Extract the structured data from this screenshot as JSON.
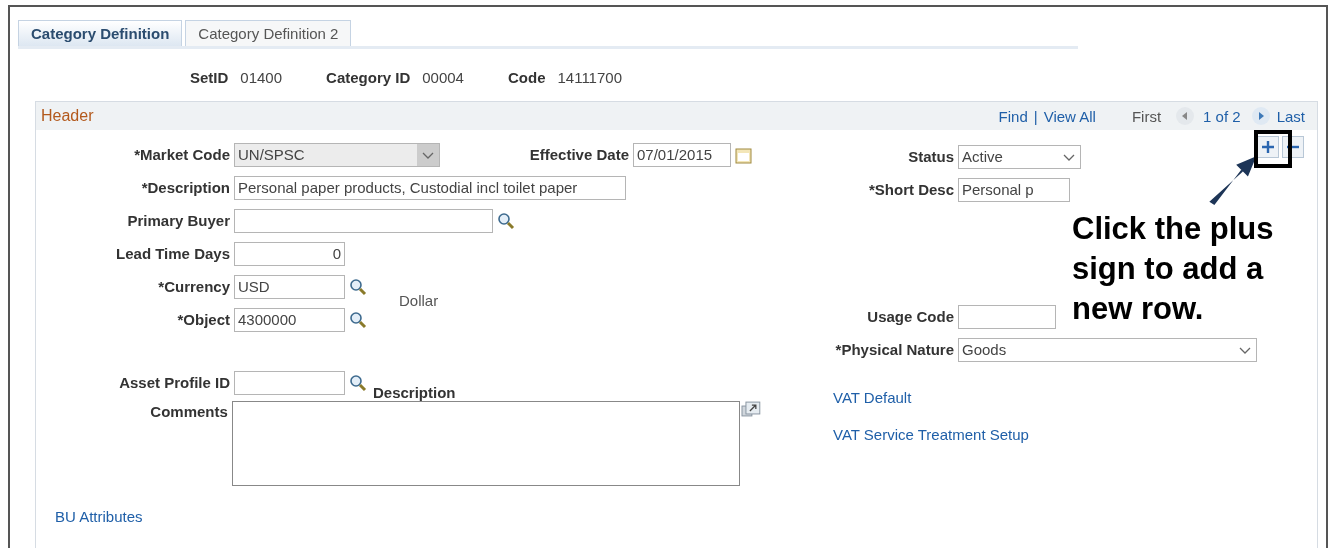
{
  "tabs": [
    {
      "label": "Category Definition",
      "selected": true
    },
    {
      "label": "Category Definition 2",
      "selected": false
    }
  ],
  "keys": [
    {
      "label": "SetID",
      "value": "01400"
    },
    {
      "label": "Category ID",
      "value": "00004"
    },
    {
      "label": "Code",
      "value": "14111700"
    }
  ],
  "header": {
    "title": "Header",
    "find": "Find",
    "separator": "|",
    "view_all": "View All",
    "first": "First",
    "page": "1 of 2",
    "last": "Last"
  },
  "left_fields": [
    {
      "label": "*Market Code",
      "value": "UN/SPSC",
      "kind": "select",
      "disabled": true
    },
    {
      "label": "*Description",
      "value": "Personal paper products, Custodial incl toilet paper",
      "kind": "text",
      "disabled": false
    },
    {
      "label": "Primary Buyer",
      "kind": "lookup",
      "disabled": false
    },
    {
      "label": "Lead Time Days",
      "value": "0",
      "kind": "number",
      "disabled": false
    }
  ],
  "effective_date": {
    "label": "Effective Date",
    "value": "07/01/2015"
  },
  "currency": {
    "label": "*Currency",
    "value": "USD"
  },
  "object": {
    "label": "*Object",
    "value": "4300000"
  },
  "currency_description": "Dollar",
  "asset_profile": {
    "label": "Asset Profile ID",
    "description_label": "Description"
  },
  "comments": {
    "label": "Comments"
  },
  "bu_attributes": "BU Attributes",
  "status": {
    "label": "Status",
    "value": "Active"
  },
  "short_desc": {
    "label": "*Short Desc",
    "value": "Personal p"
  },
  "usage_code": {
    "label": "Usage Code"
  },
  "physical_nature": {
    "label": "*Physical Nature",
    "value": "Goods"
  },
  "links": [
    "VAT Default",
    "VAT Service Treatment Setup"
  ],
  "callout": {
    "text": "Click the plus sign to add a new row."
  }
}
